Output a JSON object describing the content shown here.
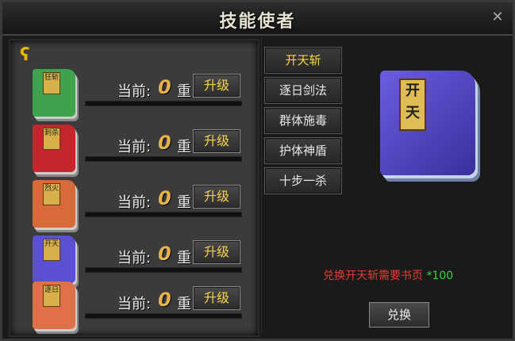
{
  "window": {
    "title": "技能使者",
    "close_icon": "close-icon"
  },
  "left": {
    "hook_icon": "hook-icon",
    "rows": [
      {
        "book_chars": "狂斩",
        "book_color": "#3fa24d",
        "current_label": "当前:",
        "level": "0",
        "level_unit": "重",
        "upgrade_label": "升级",
        "progress": 0
      },
      {
        "book_chars": "刺杀",
        "book_color": "#c4262b",
        "current_label": "当前:",
        "level": "0",
        "level_unit": "重",
        "upgrade_label": "升级",
        "progress": 0
      },
      {
        "book_chars": "烈火",
        "book_color": "#d86a3a",
        "current_label": "当前:",
        "level": "0",
        "level_unit": "重",
        "upgrade_label": "升级",
        "progress": 0
      },
      {
        "book_chars": "开天",
        "book_color": "#5b4fd3",
        "current_label": "当前:",
        "level": "0",
        "level_unit": "重",
        "upgrade_label": "升级",
        "progress": 0
      },
      {
        "book_chars": "逐日",
        "book_color": "#e0704a",
        "current_label": "当前:",
        "level": "0",
        "level_unit": "重",
        "upgrade_label": "升级",
        "progress": 0
      }
    ]
  },
  "right": {
    "skills": [
      {
        "label": "开天斩",
        "active": true
      },
      {
        "label": "逐日剑法",
        "active": false
      },
      {
        "label": "群体施毒",
        "active": false
      },
      {
        "label": "护体神盾",
        "active": false
      },
      {
        "label": "十步一杀",
        "active": false
      }
    ],
    "large_book_chars": "开天",
    "exchange_msg": "兑换开天斩需要书页",
    "exchange_qty": "*100",
    "exchange_button": "兑换",
    "colors": {
      "active_tab_text": "#f6d547",
      "msg_red": "#e53b35",
      "qty_green": "#39d33d"
    }
  }
}
